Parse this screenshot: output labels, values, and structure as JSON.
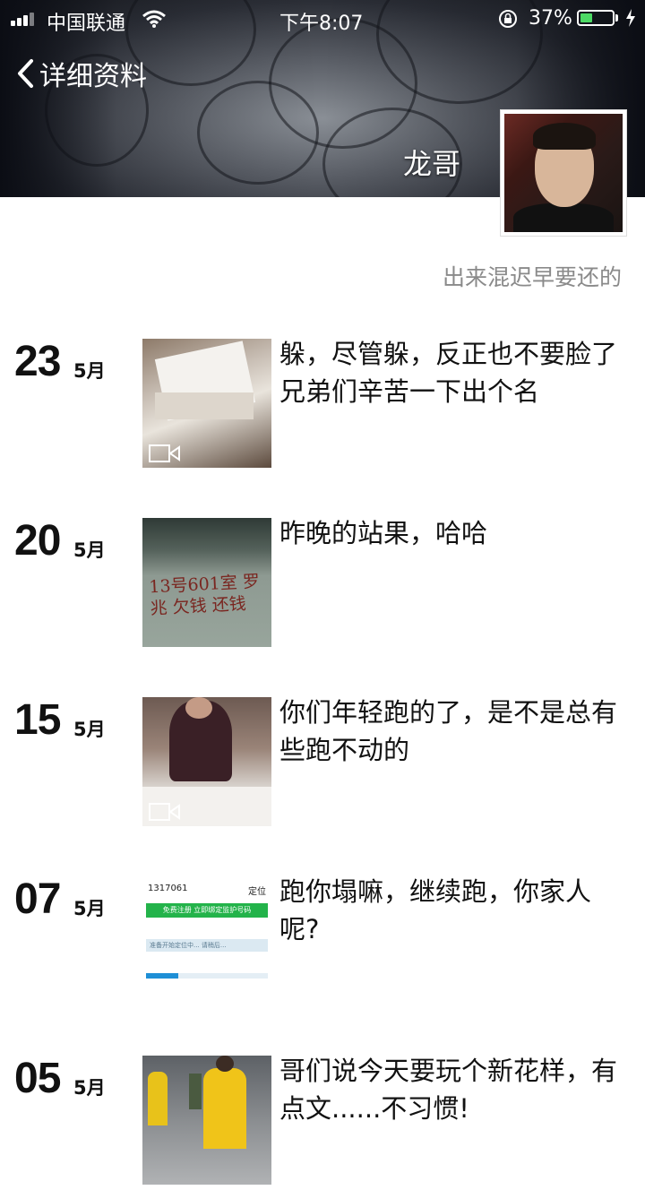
{
  "status_bar": {
    "carrier": "中国联通",
    "time": "下午8:07",
    "battery_percent": "37%",
    "battery_level": 0.37
  },
  "header": {
    "back_label": "详细资料",
    "nickname": "龙哥",
    "signature": "出来混迟早要还的"
  },
  "posts": [
    {
      "day": "23",
      "month": "5月",
      "text": "躲，尽管躲，反正也不要脸了  兄弟们辛苦一下出个名",
      "has_video": true
    },
    {
      "day": "20",
      "month": "5月",
      "text": "昨晚的站果，哈哈",
      "has_video": false,
      "image_text": "13号601室 罗兆 欠钱 还钱"
    },
    {
      "day": "15",
      "month": "5月",
      "text": "你们年轻跑的了，是不是总有些跑不动的",
      "has_video": true
    },
    {
      "day": "07",
      "month": "5月",
      "text": "跑你塌嘛，继续跑，你家人呢?",
      "has_video": false,
      "image_text": [
        "1317061",
        "定位",
        "免费注册 立即绑定监护号码",
        "准备开始定位中... 请稍后..."
      ]
    },
    {
      "day": "05",
      "month": "5月",
      "text": "哥们说今天要玩个新花样，有点文......不习惯!",
      "has_video": false
    }
  ]
}
